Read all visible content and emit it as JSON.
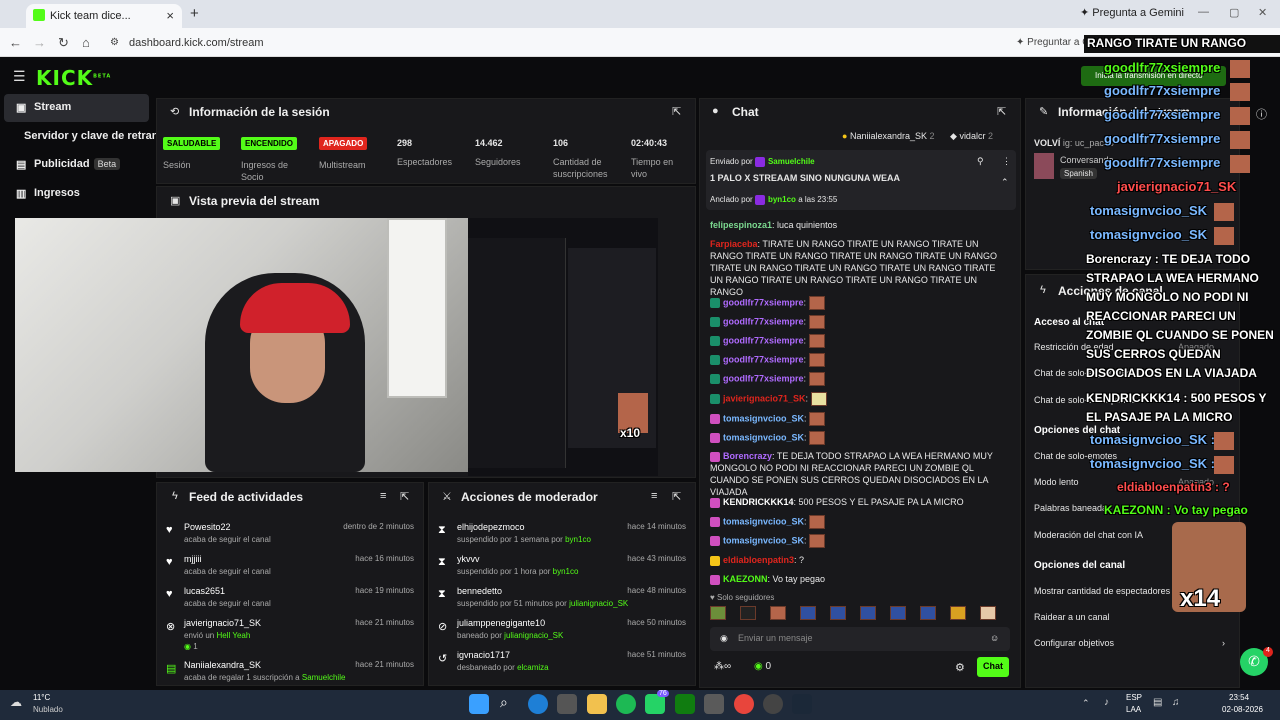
{
  "browser": {
    "tab_title": "Kick team dice...",
    "url": "dashboard.kick.com/stream",
    "gemini": "Pregunta a Gemini",
    "gemini_bar": "Preguntar a G"
  },
  "sidebar": {
    "items": [
      {
        "label": "Stream"
      },
      {
        "label": "Servidor y clave de retransmisión"
      },
      {
        "label": "Publicidad",
        "badge": "Beta"
      },
      {
        "label": "Ingresos"
      }
    ],
    "logo": "KICK",
    "logo_sup": "BETA"
  },
  "session": {
    "title": "Información de la sesión",
    "stats": [
      {
        "badge": "SALUDABLE",
        "label": "Sesión",
        "color": "#53fc18"
      },
      {
        "badge": "ENCENDIDO",
        "label": "Ingresos de Socio",
        "color": "#53fc18"
      },
      {
        "badge": "APAGADO",
        "label": "Multistream",
        "color": "#e0251d"
      },
      {
        "value": "298",
        "label": "Espectadores"
      },
      {
        "value": "14.462",
        "label": "Seguidores"
      },
      {
        "value": "106",
        "label": "Cantidad de suscripciones"
      },
      {
        "value": "02:40:43",
        "label": "Tiempo en vivo"
      }
    ]
  },
  "preview": {
    "title": "Vista previa del stream",
    "x10": "x10"
  },
  "feed": {
    "title": "Feed de actividades",
    "items": [
      {
        "name": "Powesito22",
        "sub": "acaba de seguir el canal",
        "time": "dentro de 2 minutos"
      },
      {
        "name": "mjjiii",
        "sub": "acaba de seguir el canal",
        "time": "hace 16 minutos"
      },
      {
        "name": "lucas2651",
        "sub": "acaba de seguir el canal",
        "time": "hace 19 minutos"
      },
      {
        "name": "javierignacio71_SK",
        "sub": "envió un",
        "sub2": "Hell Yeah",
        "extra": "1",
        "time": "hace 21 minutos"
      },
      {
        "name": "Naniialexandra_SK",
        "sub": "acaba de regalar 1 suscripción a",
        "sub2": "Samuelchile",
        "time": "hace 21 minutos"
      }
    ]
  },
  "mod": {
    "title": "Acciones de moderador",
    "items": [
      {
        "name": "elhijodepezmoco",
        "sub": "suspendido por 1 semana por",
        "by": "byn1co",
        "time": "hace 14 minutos"
      },
      {
        "name": "ykvvv",
        "sub": "suspendido por 1 hora por",
        "by": "byn1co",
        "time": "hace 43 minutos"
      },
      {
        "name": "bennedetto",
        "sub": "suspendido por 51 minutos por",
        "by": "julianignacio_SK",
        "time": "hace 48 minutos"
      },
      {
        "name": "juliamppenegigante10",
        "sub": "baneado por",
        "by": "julianignacio_SK",
        "time": "hace 50 minutos"
      },
      {
        "name": "igvnacio1717",
        "sub": "desbaneado por",
        "by": "elcamiza",
        "time": "hace 51 minutos"
      }
    ]
  },
  "chat": {
    "title": "Chat",
    "top_users": [
      {
        "name": "Naniialexandra_SK",
        "count": "2"
      },
      {
        "name": "vidalcr",
        "count": "2"
      }
    ],
    "pinned": {
      "by_label": "Enviado por",
      "by_user": "Samuelchile",
      "text": "1 PALO X STREAAM SINO NUNGUNA WEAA",
      "anchored": "Anclado por",
      "anchored_user": "byn1co",
      "anchored_time": "a las 23:55"
    },
    "messages": [
      {
        "user": "felipespinoza1",
        "color": "#7bd88f",
        "text": "luca quinientos"
      },
      {
        "user": "Farpiaceba",
        "color": "#e0251d",
        "text": "TIRATE UN RANGO TIRATE UN RANGO TIRATE UN RANGO TIRATE UN RANGO TIRATE UN RANGO TIRATE UN RANGO TIRATE UN RANGO TIRATE UN RANGO TIRATE UN RANGO TIRATE UN RANGO TIRATE UN RANGO TIRATE UN RANGO TIRATE UN RANGO"
      },
      {
        "user": "goodlfr77xsiempre",
        "color": "#b06bff",
        "text": ""
      },
      {
        "user": "goodlfr77xsiempre",
        "color": "#b06bff",
        "text": ""
      },
      {
        "user": "goodlfr77xsiempre",
        "color": "#b06bff",
        "text": ""
      },
      {
        "user": "goodlfr77xsiempre",
        "color": "#b06bff",
        "text": ""
      },
      {
        "user": "goodlfr77xsiempre",
        "color": "#b06bff",
        "text": ""
      },
      {
        "user": "javierignacio71_SK",
        "color": "#e0251d",
        "text": ""
      },
      {
        "user": "tomasignvcioo_SK",
        "color": "#7ab8ff",
        "text": ""
      },
      {
        "user": "tomasignvcioo_SK",
        "color": "#7ab8ff",
        "text": ""
      },
      {
        "user": "Borencrazy",
        "color": "#b06bff",
        "text": "TE DEJA TODO STRAPAO LA WEA HERMANO MUY MONGOLO NO PODI NI REACCIONAR PARECI UN ZOMBIE QL CUANDO SE PONEN SUS CERROS QUEDAN DISOCIADOS EN LA VIAJADA"
      },
      {
        "user": "KENDRICKKK14",
        "color": "#ffffff",
        "text": "500 PESOS Y EL PASAJE PA LA MICRO"
      },
      {
        "user": "tomasignvcioo_SK",
        "color": "#7ab8ff",
        "text": ""
      },
      {
        "user": "tomasignvcioo_SK",
        "color": "#7ab8ff",
        "text": ""
      },
      {
        "user": "eldiabloenpatin3",
        "color": "#e0251d",
        "text": "?"
      },
      {
        "user": "KAEZONN",
        "color": "#53fc18",
        "text": "Vo tay pegao"
      }
    ],
    "followers_only": "Solo seguidores",
    "placeholder": "Enviar un mensaje",
    "count": "0",
    "send": "Chat"
  },
  "stream_info": {
    "title": "Información del stream",
    "partial": "VOLVÍ",
    "partial2": "ig: uc_pacho",
    "conv": "Conversando",
    "lang": "Spanish"
  },
  "channel_actions": {
    "title": "Acciones de canal",
    "sections": [
      {
        "header": "Acceso al chat",
        "items": [
          "Restricción de edad",
          "Chat de solo-seguidores",
          "Chat de solo-suscriptores"
        ]
      },
      {
        "header": "Opciones del chat",
        "items": [
          "Chat de solo-emotes",
          "Modo lento",
          "Palabras baneadas",
          "Moderación del chat con IA"
        ]
      },
      {
        "header": "Opciones del canal",
        "items": [
          "Mostrar cantidad de espectadores",
          "Raidear a un canal",
          "Configurar objetivos"
        ]
      }
    ],
    "state_off": "Apagado",
    "ia_state": "Apagado"
  },
  "overlay": {
    "banner": "RANGO TIRATE UN RANGO",
    "live_hint": "Inicia la transmisión en directo",
    "x14": "x14",
    "lines": [
      {
        "user": "goodlfr77xsiempre",
        "cls": "g"
      },
      {
        "user": "goodlfr77xsiempre",
        "cls": "b"
      },
      {
        "user": "goodlfr77xsiempre",
        "cls": "b"
      },
      {
        "user": "goodlfr77xsiempre",
        "cls": "b"
      },
      {
        "user": "goodlfr77xsiempre",
        "cls": "b"
      },
      {
        "user": "javierignacio71_SK",
        "cls": "r"
      },
      {
        "user": "tomasignvcioo_SK",
        "cls": "b"
      },
      {
        "user": "tomasignvcioo_SK",
        "cls": "b"
      }
    ],
    "long": "Borencrazy : TE DEJA TODO STRAPAO LA WEA HERMANO MUY MONGOLO NO PODI NI REACCIONAR PARECI UN ZOMBIE QL CUANDO SE PONEN SUS CERROS QUEDAN DISOCIADOS EN LA VIAJADA",
    "kend": "KENDRICKKK14 : 500 PESOS Y EL PASAJE PA LA MICRO",
    "tom1": "tomasignvcioo_SK :",
    "tom2": "tomasignvcioo_SK :",
    "diablo": "eldiabloenpatin3 : ?",
    "kae": "KAEZONN : Vo tay pegao"
  },
  "taskbar": {
    "temp": "11°C",
    "weather": "Nublado",
    "lang1": "ESP",
    "lang2": "LAA",
    "time": "23:54",
    "date": "02-08-2026",
    "badge": "76",
    "notif": "4"
  }
}
